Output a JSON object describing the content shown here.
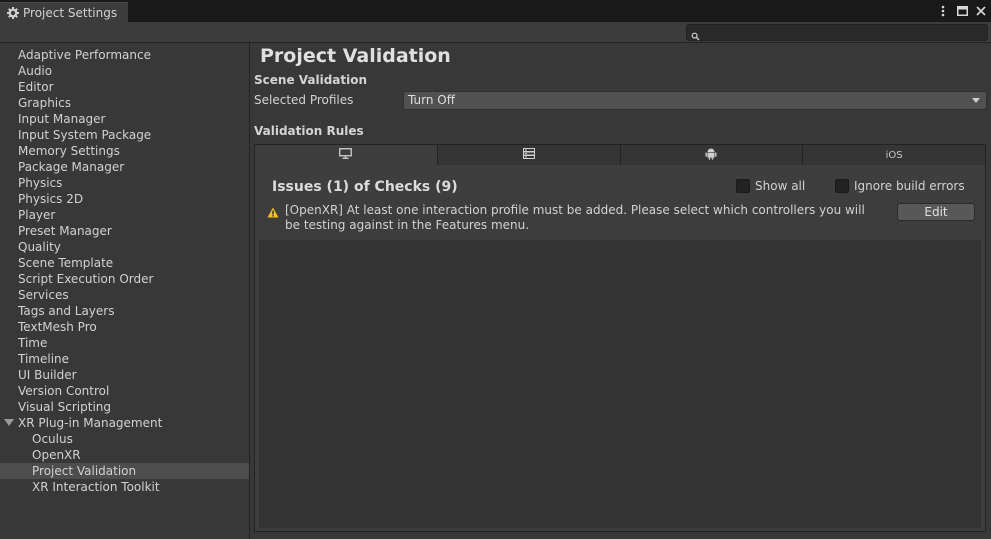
{
  "window": {
    "tab_title": "Project Settings",
    "tab_icon": "gear-icon",
    "buttons": [
      "more-icon",
      "maximize-icon",
      "close-icon"
    ]
  },
  "search": {
    "placeholder": "",
    "value": ""
  },
  "sidebar": {
    "items": [
      {
        "label": "Adaptive Performance"
      },
      {
        "label": "Audio"
      },
      {
        "label": "Editor"
      },
      {
        "label": "Graphics"
      },
      {
        "label": "Input Manager"
      },
      {
        "label": "Input System Package"
      },
      {
        "label": "Memory Settings"
      },
      {
        "label": "Package Manager"
      },
      {
        "label": "Physics"
      },
      {
        "label": "Physics 2D"
      },
      {
        "label": "Player"
      },
      {
        "label": "Preset Manager"
      },
      {
        "label": "Quality"
      },
      {
        "label": "Scene Template"
      },
      {
        "label": "Script Execution Order"
      },
      {
        "label": "Services"
      },
      {
        "label": "Tags and Layers"
      },
      {
        "label": "TextMesh Pro"
      },
      {
        "label": "Time"
      },
      {
        "label": "Timeline"
      },
      {
        "label": "UI Builder"
      },
      {
        "label": "Version Control"
      },
      {
        "label": "Visual Scripting"
      },
      {
        "label": "XR Plug-in Management",
        "expanded": true
      },
      {
        "label": "Oculus",
        "child": true
      },
      {
        "label": "OpenXR",
        "child": true
      },
      {
        "label": "Project Validation",
        "child": true,
        "selected": true
      },
      {
        "label": "XR Interaction Toolkit",
        "child": true
      }
    ]
  },
  "main": {
    "title": "Project Validation",
    "scene_validation": {
      "heading": "Scene Validation",
      "profiles_label": "Selected Profiles",
      "profiles_value": "Turn Off"
    },
    "validation_rules": {
      "heading": "Validation Rules",
      "platform_tabs": [
        {
          "icon": "desktop-icon",
          "label": ""
        },
        {
          "icon": "server-icon",
          "label": ""
        },
        {
          "icon": "android-icon",
          "label": ""
        },
        {
          "icon": "",
          "label": "iOS"
        }
      ],
      "issues_title": "Issues (1) of Checks (9)",
      "show_all_label": "Show all",
      "ignore_build_errors_label": "Ignore build errors",
      "issues": [
        {
          "icon": "warning-icon",
          "message": "[OpenXR] At least one interaction profile must be added.  Please select which controllers you will be testing against in the Features menu.",
          "button_label": "Edit"
        }
      ]
    }
  },
  "colors": {
    "background": "#383838",
    "selected_item": "#4d4d4d",
    "warning": "#f4c21b"
  }
}
